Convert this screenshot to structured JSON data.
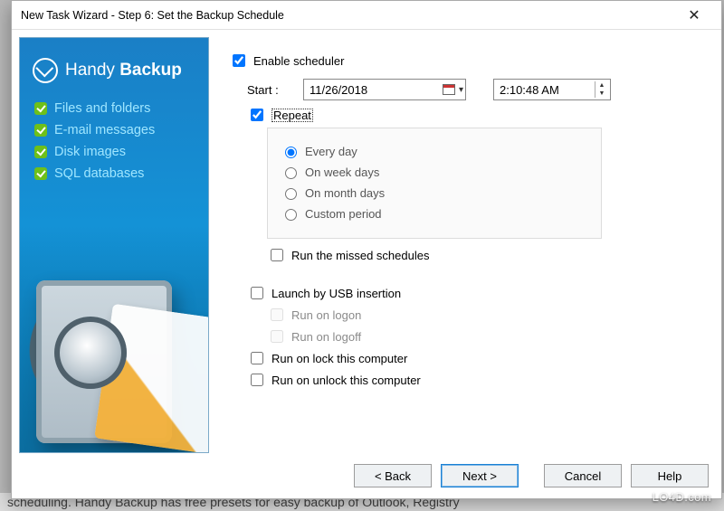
{
  "window": {
    "title": "New Task Wizard - Step 6: Set the Backup Schedule"
  },
  "sidebar": {
    "brand_light": "Handy",
    "brand_bold": "Backup",
    "features": [
      "Files and folders",
      "E-mail messages",
      "Disk images",
      "SQL databases"
    ]
  },
  "form": {
    "enable_scheduler": {
      "label": "Enable scheduler",
      "checked": true
    },
    "start_label": "Start :",
    "date_value": "11/26/2018",
    "time_value": "2:10:48 AM",
    "repeat": {
      "label": "Repeat",
      "checked": true
    },
    "repeat_options": {
      "every_day": {
        "label": "Every day",
        "selected": true
      },
      "week_days": {
        "label": "On week days",
        "selected": false
      },
      "month_days": {
        "label": "On month days",
        "selected": false
      },
      "custom": {
        "label": "Custom period",
        "selected": false
      }
    },
    "run_missed": {
      "label": "Run the missed schedules",
      "checked": false
    },
    "launch_usb": {
      "label": "Launch by USB insertion",
      "checked": false
    },
    "run_on_logon": {
      "label": "Run on logon",
      "checked": false,
      "disabled": true
    },
    "run_on_logoff": {
      "label": "Run on logoff",
      "checked": false,
      "disabled": true
    },
    "run_on_lock": {
      "label": "Run on lock this computer",
      "checked": false
    },
    "run_on_unlock": {
      "label": "Run on unlock this computer",
      "checked": false
    }
  },
  "buttons": {
    "back": "< Back",
    "next": "Next >",
    "cancel": "Cancel",
    "help": "Help"
  },
  "background_text": "scheduling. Handy Backup has free presets for easy backup of Outlook, Registry",
  "watermark": "LO4D.com"
}
